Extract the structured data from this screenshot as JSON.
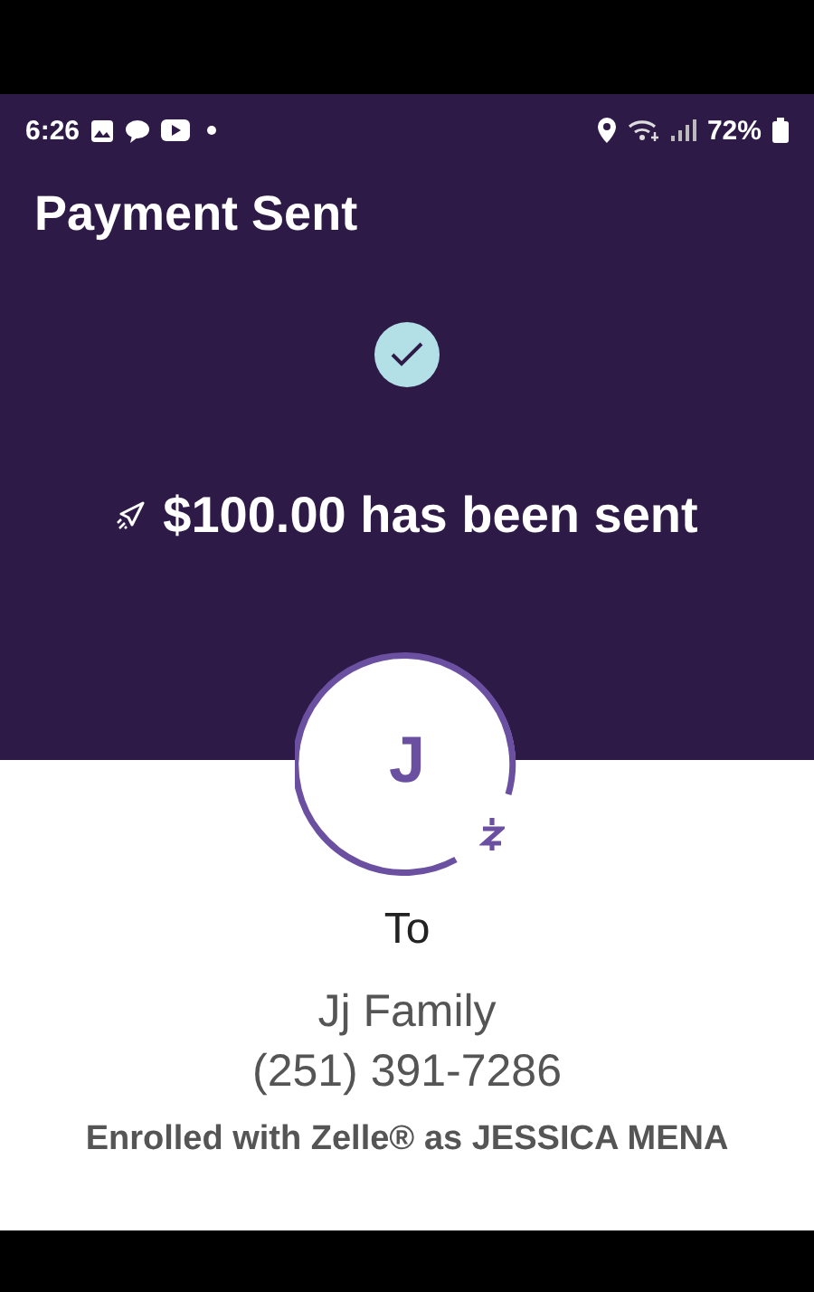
{
  "status_bar": {
    "time": "6:26",
    "battery": "72%"
  },
  "title": "Payment Sent",
  "confirmation": {
    "amount_text": "$100.00 has been sent"
  },
  "recipient": {
    "initial": "J",
    "to_label": "To",
    "name": "Jj Family",
    "phone": "(251) 391-7286",
    "enrollment": "Enrolled with Zelle® as JESSICA MENA"
  }
}
